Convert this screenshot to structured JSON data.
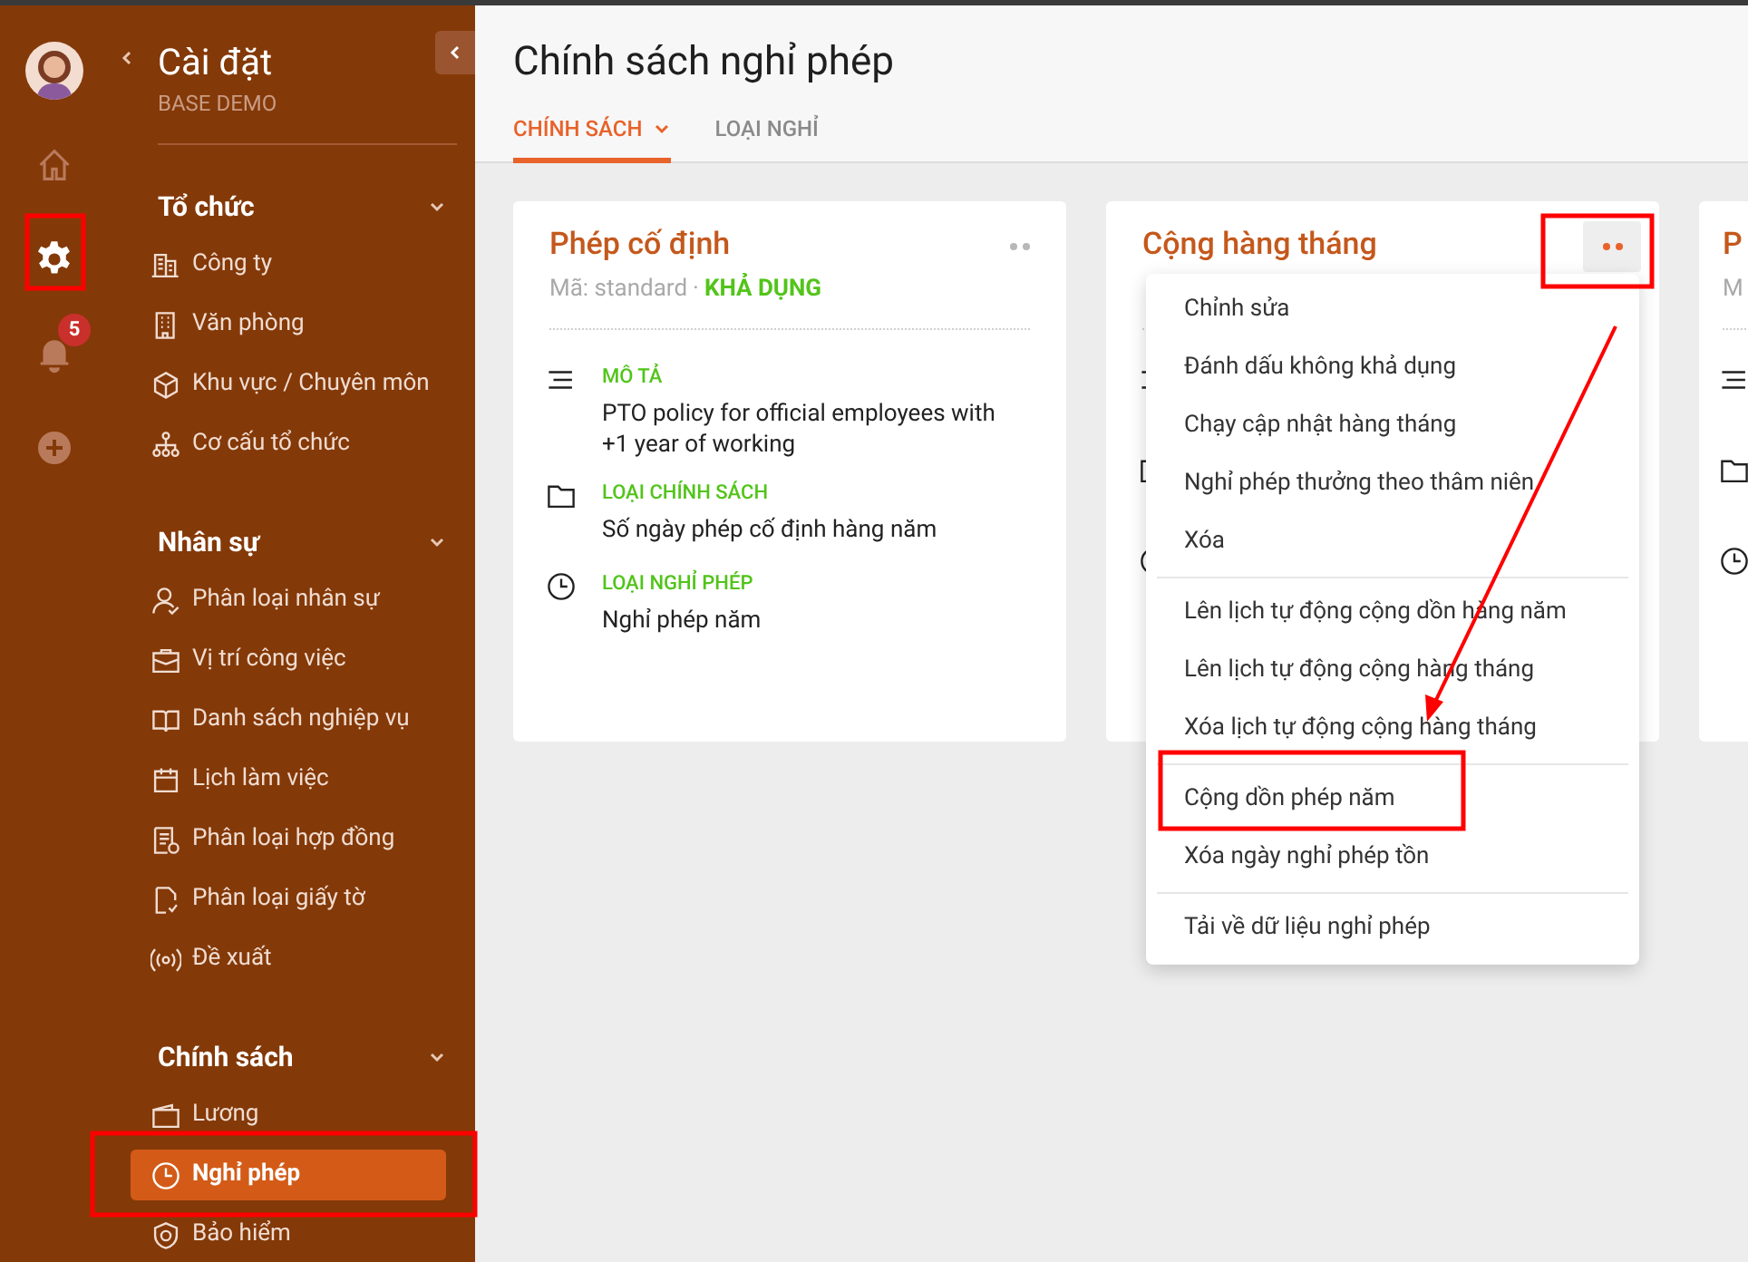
{
  "rail": {
    "notification_count": "5",
    "items": [
      {
        "kind": "home",
        "selected": false
      },
      {
        "kind": "settings",
        "selected": true
      },
      {
        "kind": "bell",
        "selected": false
      },
      {
        "kind": "add",
        "selected": false
      }
    ]
  },
  "sidebar": {
    "title": "Cài đặt",
    "subtitle": "BASE DEMO",
    "groups": [
      {
        "label": "Tổ chức",
        "expanded": true,
        "items": [
          {
            "label": "Công ty",
            "kind": "building",
            "selected": false
          },
          {
            "label": "Văn phòng",
            "kind": "office",
            "selected": false
          },
          {
            "label": "Khu vực / Chuyên môn",
            "kind": "cube",
            "selected": false
          },
          {
            "label": "Cơ cấu tổ chức",
            "kind": "org",
            "selected": false
          }
        ]
      },
      {
        "label": "Nhân sự",
        "expanded": true,
        "items": [
          {
            "label": "Phân loại nhân sự",
            "kind": "user",
            "selected": false
          },
          {
            "label": "Vị trí công việc",
            "kind": "briefcase",
            "selected": false
          },
          {
            "label": "Danh sách nghiệp vụ",
            "kind": "book",
            "selected": false
          },
          {
            "label": "Lịch làm việc",
            "kind": "calendar",
            "selected": false
          },
          {
            "label": "Phân loại hợp đồng",
            "kind": "contract",
            "selected": false
          },
          {
            "label": "Phân loại giấy tờ",
            "kind": "document",
            "selected": false
          },
          {
            "label": "Đề xuất",
            "kind": "broadcast",
            "selected": false
          }
        ]
      },
      {
        "label": "Chính sách",
        "expanded": true,
        "items": [
          {
            "label": "Lương",
            "kind": "wallet",
            "selected": false
          },
          {
            "label": "Nghỉ phép",
            "kind": "clock",
            "selected": true
          },
          {
            "label": "Bảo hiểm",
            "kind": "shield",
            "selected": false
          }
        ]
      }
    ]
  },
  "page_title": "Chính sách nghỉ phép",
  "tabs": [
    {
      "label": "CHÍNH SÁCH",
      "selected": true,
      "has_dropdown": true
    },
    {
      "label": "LOẠI NGHỈ",
      "selected": false,
      "has_dropdown": false
    }
  ],
  "cards": [
    {
      "title": "Phép cố định",
      "code": "Mã: standard",
      "separator": "·",
      "status": "KHẢ DỤNG",
      "menu_open": false,
      "fields": [
        {
          "kind": "description",
          "label": "MÔ TẢ",
          "value": "PTO policy for official employees with +1 year of working"
        },
        {
          "kind": "folder",
          "label": "LOẠI CHÍNH SÁCH",
          "value": "Số ngày phép cố định hàng năm"
        },
        {
          "kind": "clock",
          "label": "LOẠI NGHỈ PHÉP",
          "value": "Nghỉ phép năm"
        }
      ]
    },
    {
      "title": "Cộng hàng tháng",
      "menu_open": true,
      "fields": [
        {
          "kind": "description"
        },
        {
          "kind": "folder"
        },
        {
          "kind": "clock"
        }
      ]
    },
    {
      "title": "P",
      "code": "M",
      "fields": [
        {
          "kind": "description"
        },
        {
          "kind": "folder"
        },
        {
          "kind": "clock"
        }
      ]
    }
  ],
  "menu": {
    "sections": [
      [
        "Chỉnh sửa",
        "Đánh dấu không khả dụng",
        "Chạy cập nhật hàng tháng",
        "Nghỉ phép thưởng theo thâm niên",
        "Xóa"
      ],
      [
        "Lên lịch tự động cộng dồn hàng năm",
        "Lên lịch tự động cộng hàng tháng",
        "Xóa lịch tự động cộng hàng tháng"
      ],
      [
        "Cộng dồn phép năm",
        "Xóa ngày nghỉ phép tồn"
      ],
      [
        "Tải về dữ liệu nghỉ phép"
      ]
    ]
  }
}
